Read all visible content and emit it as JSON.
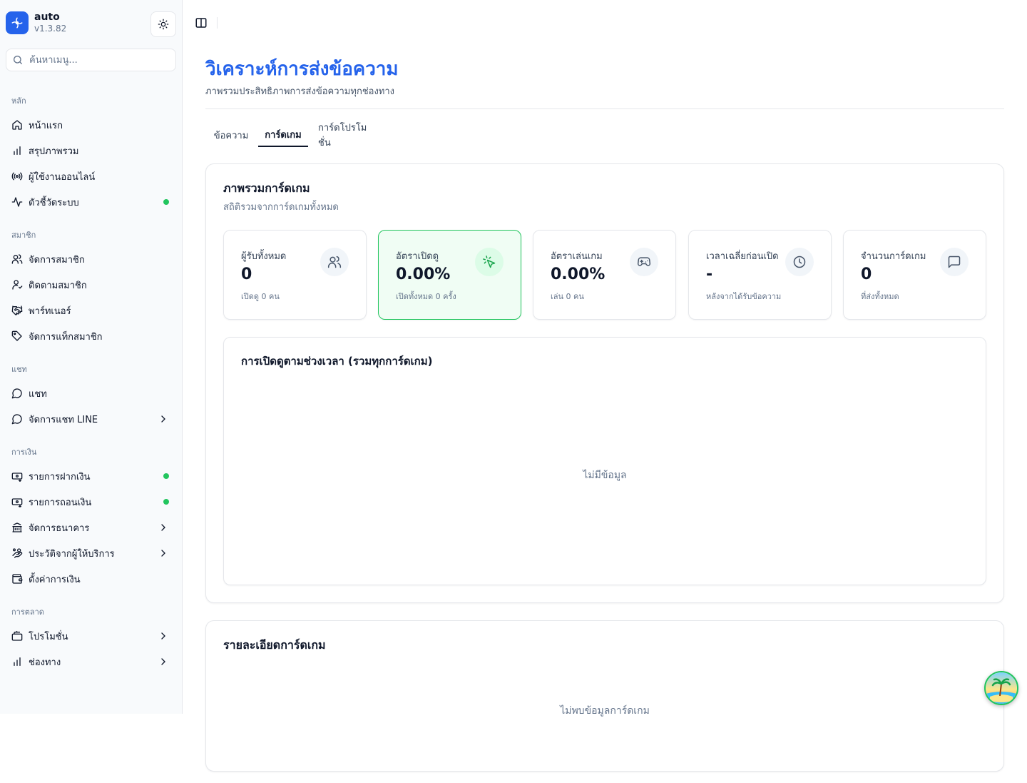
{
  "brand": {
    "name": "auto",
    "version": "v1.3.82"
  },
  "search": {
    "placeholder": "ค้นหาเมนู..."
  },
  "sidebar": {
    "groups": [
      {
        "label": "หลัก"
      },
      {
        "label": "สมาชิก"
      },
      {
        "label": "แชท"
      },
      {
        "label": "การเงิน"
      },
      {
        "label": "การตลาด"
      }
    ],
    "items": [
      {
        "label": "หน้าแรก",
        "icon": "home-icon"
      },
      {
        "label": "สรุปภาพรวม",
        "icon": "bar-chart-icon"
      },
      {
        "label": "ผู้ใช้งานออนไลน์",
        "icon": "broadcast-icon"
      },
      {
        "label": "ตัวชี้วัดระบบ",
        "icon": "activity-icon",
        "status": "online"
      },
      {
        "label": "จัดการสมาชิก",
        "icon": "users-icon"
      },
      {
        "label": "ติดตามสมาชิก",
        "icon": "user-track-icon"
      },
      {
        "label": "พาร์ทเนอร์",
        "icon": "handshake-icon"
      },
      {
        "label": "จัดการแท็กสมาชิก",
        "icon": "tag-icon"
      },
      {
        "label": "แชท",
        "icon": "chat-icon"
      },
      {
        "label": "จัดการแชท LINE",
        "icon": "chat-icon",
        "expandable": true
      },
      {
        "label": "รายการฝากเงิน",
        "icon": "deposit-icon",
        "status": "online"
      },
      {
        "label": "รายการถอนเงิน",
        "icon": "withdraw-icon",
        "status": "online"
      },
      {
        "label": "จัดการธนาคาร",
        "icon": "bank-icon",
        "expandable": true
      },
      {
        "label": "ประวัติจากผู้ให้บริการ",
        "icon": "provider-icon",
        "expandable": true
      },
      {
        "label": "ตั้งค่าการเงิน",
        "icon": "wallet-icon"
      },
      {
        "label": "โปรโมชั่น",
        "icon": "promotion-icon",
        "expandable": true
      },
      {
        "label": "ช่องทาง",
        "icon": "bar-chart-icon",
        "expandable": true
      }
    ]
  },
  "page": {
    "title": "วิเคราะห์การส่งข้อความ",
    "subtitle": "ภาพรวมประสิทธิภาพการส่งข้อความทุกช่องทาง"
  },
  "tabs": [
    {
      "label": "ข้อความ",
      "active": false
    },
    {
      "label": "การ์ดเกม",
      "active": true
    },
    {
      "label": "การ์ดโปรโมชั่น",
      "active": false
    }
  ],
  "overview": {
    "title": "ภาพรวมการ์ดเกม",
    "subtitle": "สถิติรวมจากการ์ดเกมทั้งหมด",
    "stats": [
      {
        "label": "ผู้รับทั้งหมด",
        "value": "0",
        "note": "เปิดดู 0 คน",
        "icon": "users-icon"
      },
      {
        "label": "อัตราเปิดดู",
        "value": "0.00%",
        "note": "เปิดทั้งหมด 0 ครั้ง",
        "icon": "pointer-click-icon"
      },
      {
        "label": "อัตราเล่นเกม",
        "value": "0.00%",
        "note": "เล่น 0 คน",
        "icon": "gamepad-icon"
      },
      {
        "label": "เวลาเฉลี่ยก่อนเปิด",
        "value": "-",
        "note": "หลังจากได้รับข้อความ",
        "icon": "clock-icon"
      },
      {
        "label": "จำนวนการ์ดเกม",
        "value": "0",
        "note": "ที่ส่งทั้งหมด",
        "icon": "message-square-icon"
      }
    ],
    "chart": {
      "title": "การเปิดดูตามช่วงเวลา (รวมทุกการ์ดเกม)",
      "empty_text": "ไม่มีข้อมูล"
    }
  },
  "detail": {
    "title": "รายละเอียดการ์ดเกม",
    "empty_text": "ไม่พบข้อมูลการ์ดเกม"
  },
  "colors": {
    "accent": "#2563eb",
    "success": "#22c55e",
    "muted": "#64748b"
  }
}
